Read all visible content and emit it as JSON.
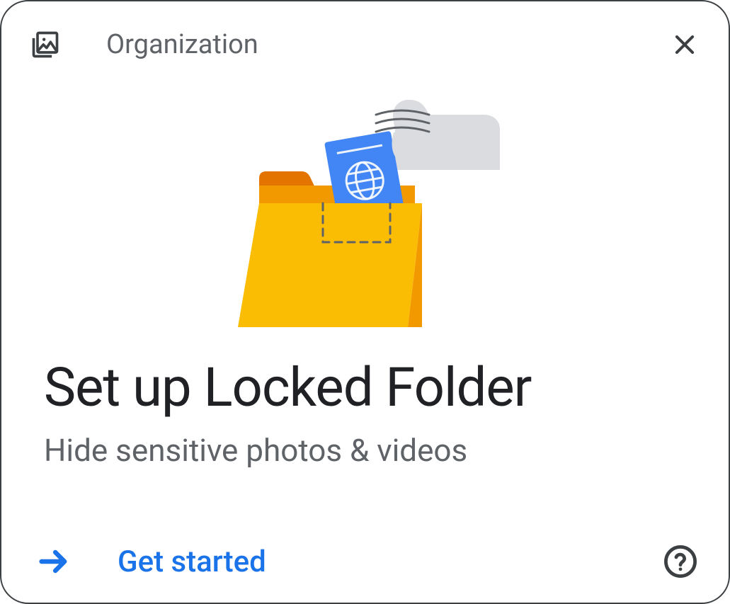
{
  "header": {
    "category": "Organization"
  },
  "content": {
    "title": "Set up Locked Folder",
    "subtitle": "Hide sensitive photos & videos"
  },
  "footer": {
    "cta": "Get started"
  },
  "icons": {
    "photos": "photos-library-icon",
    "close": "close-icon",
    "arrow": "arrow-right-icon",
    "help": "help-icon"
  },
  "colors": {
    "accent": "#1a73e8",
    "folder_main": "#fbbc04",
    "folder_dark": "#f29900",
    "folder_tab": "#e37400",
    "card_blue": "#4285f4",
    "hand_gray": "#dadce0",
    "text_primary": "#202124",
    "text_secondary": "#5f6368"
  }
}
